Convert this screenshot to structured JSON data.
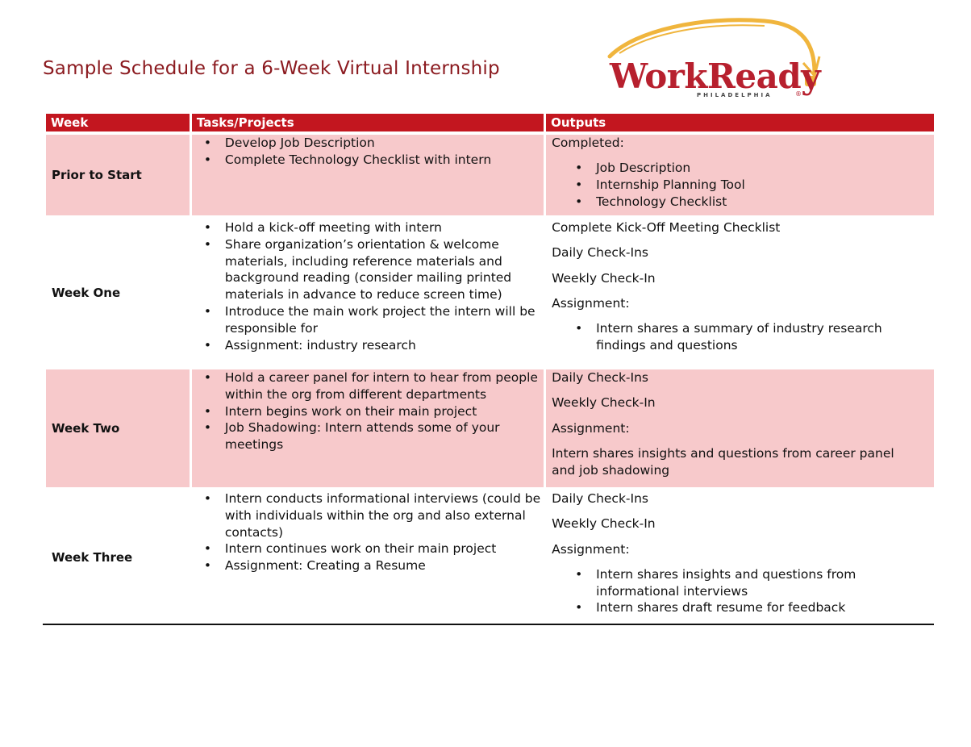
{
  "document": {
    "title": "Sample Schedule for a 6-Week Virtual Internship",
    "logo": {
      "name": "WorkReady",
      "subtitle": "PHILADELPHIA",
      "registered": "®"
    },
    "colors": {
      "header_bg": "#c3161f",
      "row_highlight": "#f7c9cb",
      "title": "#8b1a1f",
      "logo_red": "#b7202e",
      "logo_gold": "#f0b53d"
    }
  },
  "table": {
    "headers": [
      "Week",
      "Tasks/Projects",
      "Outputs"
    ],
    "rows": [
      {
        "week": "Prior to Start",
        "tasks": [
          "Develop Job Description",
          "Complete Technology Checklist with intern"
        ],
        "outputs": {
          "paragraphs": [
            "Completed:"
          ],
          "bullets": [
            "Job Description",
            "Internship Planning Tool",
            "Technology Checklist"
          ]
        }
      },
      {
        "week": "Week One",
        "tasks": [
          "Hold a kick-off meeting with intern",
          "Share organization’s orientation & welcome materials, including reference materials and background reading (consider mailing printed materials in advance to reduce screen time)",
          "Introduce the main work project the intern will be responsible for",
          "Assignment: industry research"
        ],
        "outputs": {
          "paragraphs": [
            "Complete Kick-Off Meeting Checklist",
            "Daily Check-Ins",
            "Weekly Check-In",
            "Assignment:"
          ],
          "bullets": [
            "Intern shares a summary of industry research findings and questions"
          ]
        }
      },
      {
        "week": "Week Two",
        "tasks": [
          "Hold a career panel for intern to hear from people within the org from different departments",
          "Intern begins work on their main project",
          "Job Shadowing: Intern attends some of your meetings"
        ],
        "outputs": {
          "paragraphs": [
            "Daily Check-Ins",
            "Weekly Check-In",
            "Assignment:",
            "Intern shares insights and questions from career panel and job shadowing"
          ],
          "bullets": []
        }
      },
      {
        "week": "Week Three",
        "tasks": [
          "Intern conducts informational interviews (could be with individuals within the org and also external contacts)",
          "Intern continues work on their main project",
          "Assignment: Creating a Resume"
        ],
        "outputs": {
          "paragraphs": [
            "Daily Check-Ins",
            "Weekly Check-In",
            "Assignment:"
          ],
          "bullets": [
            "Intern shares insights and questions from informational interviews",
            "Intern shares draft resume for feedback"
          ]
        }
      }
    ]
  }
}
